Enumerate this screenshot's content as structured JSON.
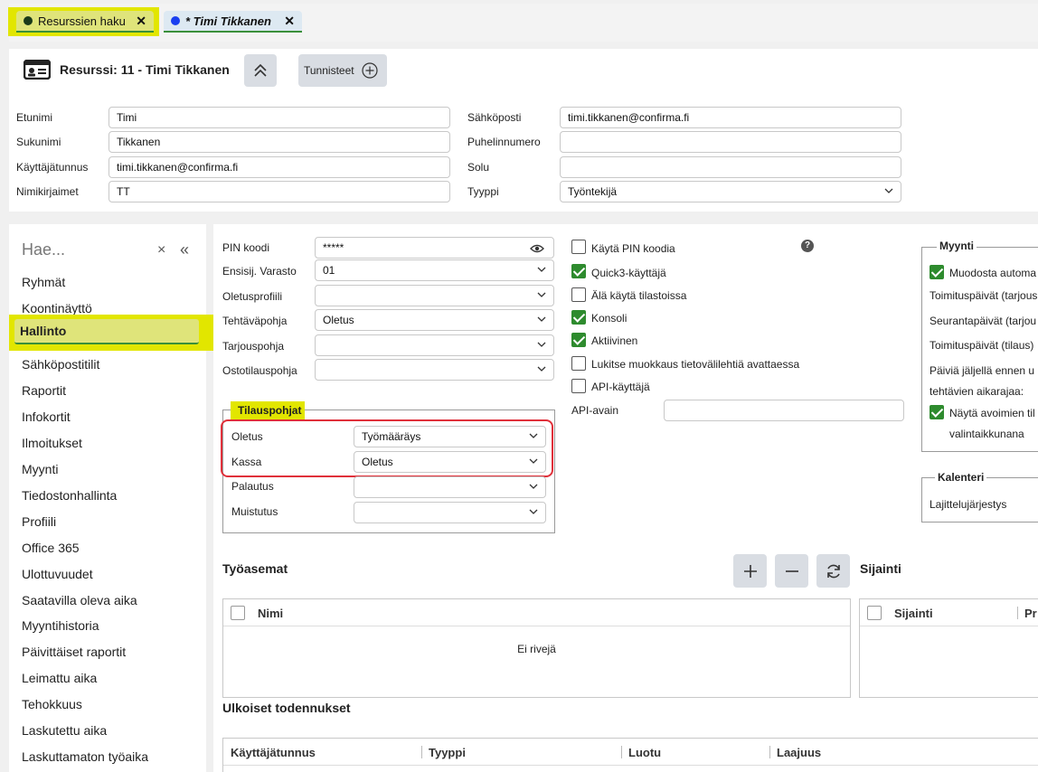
{
  "tabs": [
    {
      "label": "Resurssien haku",
      "dot_color": "#1a3a1a",
      "close": "✕"
    },
    {
      "label": "* Timi Tikkanen",
      "dot_color": "#1a3ff0",
      "close": "✕"
    }
  ],
  "header": {
    "title": "Resurssi: 11 - Timi Tikkanen",
    "tags_button": "Tunnisteet"
  },
  "form_left": [
    {
      "label": "Etunimi",
      "value": "Timi"
    },
    {
      "label": "Sukunimi",
      "value": "Tikkanen"
    },
    {
      "label": "Käyttäjätunnus",
      "value": "timi.tikkanen@confirma.fi"
    },
    {
      "label": "Nimikirjaimet",
      "value": "TT"
    }
  ],
  "form_right": [
    {
      "label": "Sähköposti",
      "value": "timi.tikkanen@confirma.fi"
    },
    {
      "label": "Puhelinnumero",
      "value": ""
    },
    {
      "label": "Solu",
      "value": ""
    },
    {
      "label": "Tyyppi",
      "value": "Työntekijä"
    }
  ],
  "sidebar": {
    "search_placeholder": "Hae...",
    "items": [
      "Ryhmät",
      "Koontinäyttö",
      "Hallinto",
      "Sähköpostitilit",
      "Raportit",
      "Infokortit",
      "Ilmoitukset",
      "Myynti",
      "Tiedostonhallinta",
      "Profiili",
      "Office 365",
      "Ulottuvuudet",
      "Saatavilla oleva aika",
      "Myyntihistoria",
      "Päivittäiset raportit",
      "Leimattu aika",
      "Tehokkuus",
      "Laskutettu aika",
      "Laskuttamaton työaika"
    ],
    "active_index": 2
  },
  "settings": {
    "pin_label": "PIN koodi",
    "pin_value": "*****",
    "fields": [
      {
        "label": "Ensisij. Varasto",
        "value": "01"
      },
      {
        "label": "Oletusprofiili",
        "value": ""
      },
      {
        "label": "Tehtäväpohja",
        "value": "Oletus"
      },
      {
        "label": "Tarjouspohja",
        "value": ""
      },
      {
        "label": "Ostotilauspohja",
        "value": ""
      }
    ]
  },
  "tilauspohjat": {
    "legend": "Tilauspohjat",
    "rows": [
      {
        "label": "Oletus",
        "value": "Työmääräys"
      },
      {
        "label": "Kassa",
        "value": "Oletus"
      },
      {
        "label": "Palautus",
        "value": ""
      },
      {
        "label": "Muistutus",
        "value": ""
      }
    ]
  },
  "checkboxes": [
    {
      "label": "Käytä PIN koodia",
      "checked": false
    },
    {
      "label": "Quick3-käyttäjä",
      "checked": true
    },
    {
      "label": "Älä käytä tilastoissa",
      "checked": false
    },
    {
      "label": "Konsoli",
      "checked": true
    },
    {
      "label": "Aktiivinen",
      "checked": true
    },
    {
      "label": "Lukitse muokkaus tietovälilehtiä avattaessa",
      "checked": false
    },
    {
      "label": "API-käyttäjä",
      "checked": false
    }
  ],
  "api_key_label": "API-avain",
  "help_icon": "?",
  "myynti": {
    "legend": "Myynti",
    "check1": "Muodosta automa",
    "lines": [
      "Toimituspäivät (tarjous",
      "Seurantapäivät (tarjou",
      "Toimituspäivät (tilaus)",
      "Päiviä jäljellä ennen u",
      "tehtävien aikarajaa:"
    ],
    "check2_line1": "Näytä avoimien til",
    "check2_line2": "valintaikkunana"
  },
  "kalenteri": {
    "legend": "Kalenteri",
    "line": "Lajittelujärjestys"
  },
  "tyoasemat": {
    "title": "Työasemat",
    "col": "Nimi",
    "empty": "Ei rivejä"
  },
  "sijainti": {
    "title": "Sijainti",
    "col1": "Sijainti",
    "col2": "Pr"
  },
  "ulkoiset": {
    "title": "Ulkoiset todennukset",
    "cols": [
      "Käyttäjätunnus",
      "Tyyppi",
      "Luotu",
      "Laajuus"
    ]
  }
}
